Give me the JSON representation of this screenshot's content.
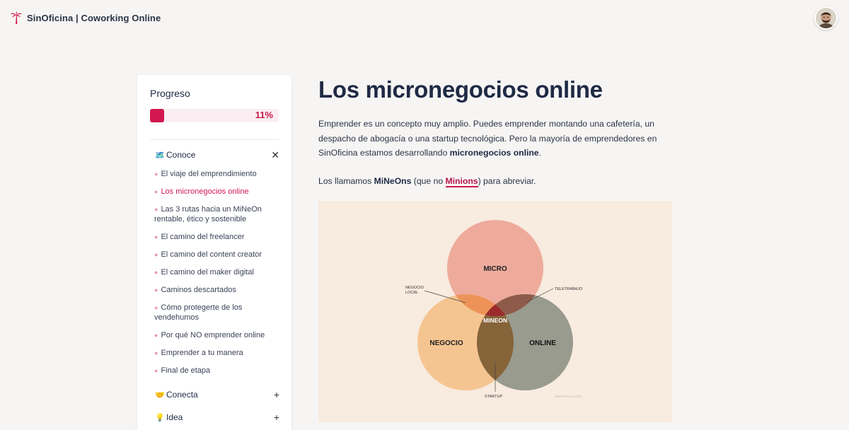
{
  "header": {
    "brand_title": "SinOficina | Coworking Online",
    "colors": {
      "brand": "#d2184e"
    }
  },
  "sidebar": {
    "progress_title": "Progreso",
    "progress_value": 11,
    "progress_label": "11%",
    "sections": [
      {
        "emoji": "🗺️",
        "label": "Conoce",
        "toggle": "✕",
        "expanded": true,
        "lessons": [
          "El viaje del emprendimiento",
          "Los micronegocios online",
          "Las 3 rutas hacia un MiNeOn rentable, ético y sostenible",
          "El camino del freelancer",
          "El camino del content creator",
          "El camino del maker digital",
          "Caminos descartados",
          "Cómo protegerte de los vendehumos",
          "Por qué NO emprender online",
          "Emprender a tu manera",
          "Final de etapa"
        ],
        "active_lesson": 1
      },
      {
        "emoji": "🤝",
        "label": "Conecta",
        "toggle": "+",
        "expanded": false
      },
      {
        "emoji": "💡",
        "label": "Idea",
        "toggle": "+",
        "expanded": false
      }
    ]
  },
  "main": {
    "title": "Los micronegocios online",
    "p1_text": "Emprender es un concepto muy amplio. Puedes emprender montando una cafetería, un despacho de abogacía o una startup tecnológica. Pero la mayoría de emprendedores en SinOficina estamos desarrollando ",
    "p1_bold": "micronegocios online",
    "p1_end": ".",
    "p2_start": "Los llamamos ",
    "p2_bold": "MiNeOns",
    "p2_mid": " (que no ",
    "p2_link": "Minions",
    "p2_end": ") para abreviar."
  },
  "venn": {
    "circles": [
      "MICRO",
      "NEGOCIO",
      "ONLINE"
    ],
    "center": "MINEON",
    "annotations": {
      "negocio_local_1": "NEGOCIO",
      "negocio_local_2": "LOCAL",
      "teletrabajo": "TELETRABAJO",
      "startup": "STARTUP"
    },
    "watermark": "SINOFICINA.COM",
    "colors": {
      "micro": "#eeab9c",
      "negocio": "#f4b877",
      "online": "#7d8477",
      "background": "#f8ebdf"
    }
  }
}
